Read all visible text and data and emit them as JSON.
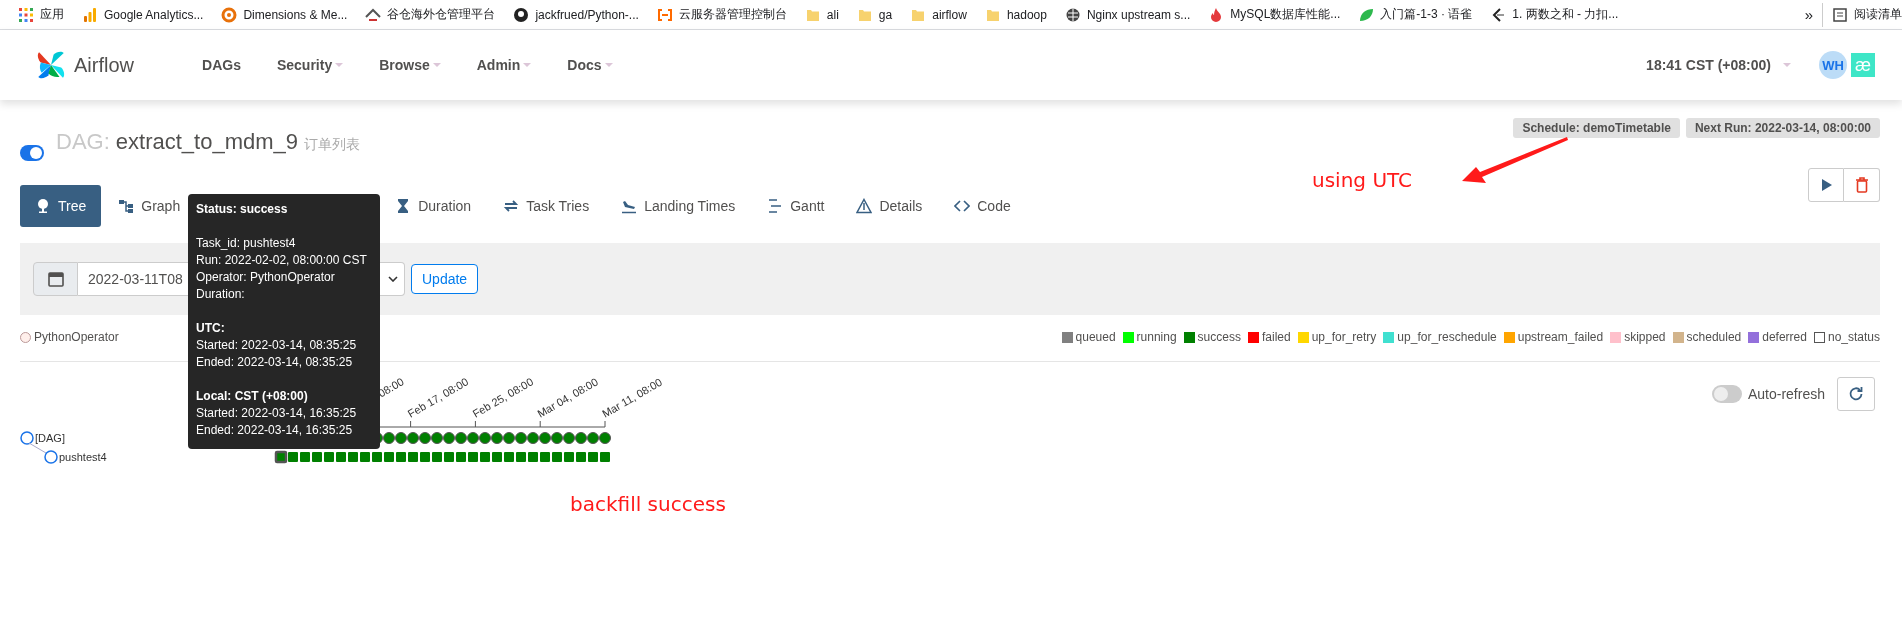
{
  "bookmarks": {
    "items": [
      {
        "kind": "apps",
        "label": "应用"
      },
      {
        "kind": "analytics",
        "label": "Google Analytics..."
      },
      {
        "kind": "dimensions",
        "label": "Dimensions & Me..."
      },
      {
        "kind": "warehouse",
        "label": "谷仓海外仓管理平台"
      },
      {
        "kind": "github",
        "label": "jackfrued/Python-..."
      },
      {
        "kind": "cloud",
        "label": "云服务器管理控制台"
      },
      {
        "kind": "folder",
        "label": "ali"
      },
      {
        "kind": "folder",
        "label": "ga"
      },
      {
        "kind": "folder",
        "label": "airflow"
      },
      {
        "kind": "folder",
        "label": "hadoop"
      },
      {
        "kind": "globe",
        "label": "Nginx upstream s..."
      },
      {
        "kind": "flame",
        "label": "MySQL数据库性能..."
      },
      {
        "kind": "leaf",
        "label": "入门篇-1-3 · 语雀"
      },
      {
        "kind": "leetcode",
        "label": "1. 两数之和 - 力扣..."
      }
    ],
    "more": "»",
    "reading_list": "阅读清单"
  },
  "navbar": {
    "brand": "Airflow",
    "menu": [
      {
        "label": "DAGs",
        "dropdown": false
      },
      {
        "label": "Security",
        "dropdown": true
      },
      {
        "label": "Browse",
        "dropdown": true
      },
      {
        "label": "Admin",
        "dropdown": true
      },
      {
        "label": "Docs",
        "dropdown": true
      }
    ],
    "clock": "18:41 CST (+08:00)",
    "avatar": "WH",
    "extension": "æ"
  },
  "dag": {
    "on": true,
    "prefix": "DAG:",
    "id": "extract_to_mdm_9",
    "description": "订单列表",
    "schedule": "Schedule: demoTimetable",
    "next_run": "Next Run: 2022-03-14, 08:00:00"
  },
  "tabs": [
    {
      "kind": "tree",
      "label": "Tree",
      "selected": true
    },
    {
      "kind": "graph",
      "label": "Graph",
      "selected": false
    },
    {
      "kind": "duration",
      "label": "Duration",
      "selected": false
    },
    {
      "kind": "tries",
      "label": "Task Tries",
      "selected": false
    },
    {
      "kind": "landing",
      "label": "Landing Times",
      "selected": false
    },
    {
      "kind": "gantt",
      "label": "Gantt",
      "selected": false
    },
    {
      "kind": "details",
      "label": "Details",
      "selected": false
    },
    {
      "kind": "code",
      "label": "Code",
      "selected": false
    }
  ],
  "filter": {
    "base_date": "2022-03-11T08",
    "button": "Update"
  },
  "legend": {
    "operators": [
      {
        "label": "PythonOperator",
        "color": "#ffefeb"
      }
    ],
    "states": [
      {
        "label": "queued",
        "color": "#808080"
      },
      {
        "label": "running",
        "color": "#00ff00"
      },
      {
        "label": "success",
        "color": "#008000"
      },
      {
        "label": "failed",
        "color": "#ff0000"
      },
      {
        "label": "up_for_retry",
        "color": "#ffd700"
      },
      {
        "label": "up_for_reschedule",
        "color": "#40e0d0"
      },
      {
        "label": "upstream_failed",
        "color": "#ffa500"
      },
      {
        "label": "skipped",
        "color": "#ffc0cb"
      },
      {
        "label": "scheduled",
        "color": "#d2b48c"
      },
      {
        "label": "deferred",
        "color": "#9370db"
      },
      {
        "label": "no_status",
        "color": "#ffffff"
      }
    ]
  },
  "auto_refresh": {
    "label": "Auto-refresh",
    "on": false
  },
  "tree": {
    "ticks": [
      "08:00",
      "Feb 17, 08:00",
      "Feb 25, 08:00",
      "Mar 04, 08:00",
      "Mar 11, 08:00"
    ],
    "nodes": [
      {
        "label": "[DAG]",
        "runs": [
          {
            "color": "#008000",
            "hovered": false
          },
          {
            "color": "#008000",
            "hovered": false
          },
          {
            "color": "#008000",
            "hovered": false
          },
          {
            "color": "#008000",
            "hovered": false
          },
          {
            "color": "#008000",
            "hovered": false
          },
          {
            "color": "#008000",
            "hovered": false
          },
          {
            "color": "#008000",
            "hovered": false
          },
          {
            "color": "#008000",
            "hovered": false
          },
          {
            "color": "#008000",
            "hovered": false
          },
          {
            "color": "#008000",
            "hovered": false
          },
          {
            "color": "#008000",
            "hovered": false
          },
          {
            "color": "#008000",
            "hovered": false
          },
          {
            "color": "#008000",
            "hovered": false
          },
          {
            "color": "#008000",
            "hovered": false
          },
          {
            "color": "#008000",
            "hovered": false
          },
          {
            "color": "#008000",
            "hovered": false
          },
          {
            "color": "#008000",
            "hovered": false
          },
          {
            "color": "#008000",
            "hovered": false
          },
          {
            "color": "#008000",
            "hovered": false
          },
          {
            "color": "#008000",
            "hovered": false
          }
        ],
        "children": [
          {
            "label": "pushtest4",
            "runs": [
              {
                "color": "#008000",
                "hovered": true
              },
              {
                "color": "#008000",
                "hovered": false
              },
              {
                "color": "#008000",
                "hovered": false
              },
              {
                "color": "#008000",
                "hovered": false
              },
              {
                "color": "#008000",
                "hovered": false
              },
              {
                "color": "#008000",
                "hovered": false
              },
              {
                "color": "#008000",
                "hovered": false
              },
              {
                "color": "#008000",
                "hovered": false
              },
              {
                "color": "#008000",
                "hovered": false
              },
              {
                "color": "#008000",
                "hovered": false
              },
              {
                "color": "#008000",
                "hovered": false
              },
              {
                "color": "#008000",
                "hovered": false
              },
              {
                "color": "#008000",
                "hovered": false
              },
              {
                "color": "#008000",
                "hovered": false
              },
              {
                "color": "#008000",
                "hovered": false
              },
              {
                "color": "#008000",
                "hovered": false
              },
              {
                "color": "#008000",
                "hovered": false
              },
              {
                "color": "#008000",
                "hovered": false
              },
              {
                "color": "#008000",
                "hovered": false
              },
              {
                "color": "#008000",
                "hovered": false
              },
              {
                "color": "#008000",
                "hovered": false
              },
              {
                "color": "#008000",
                "hovered": false
              },
              {
                "color": "#008000",
                "hovered": false
              },
              {
                "color": "#008000",
                "hovered": false
              },
              {
                "color": "#008000",
                "hovered": false
              },
              {
                "color": "#008000",
                "hovered": false
              },
              {
                "color": "#008000",
                "hovered": false
              },
              {
                "color": "#008000",
                "hovered": false
              }
            ]
          }
        ]
      }
    ]
  },
  "tooltip": {
    "sections": [
      [
        {
          "kind": "heading",
          "text": "Status: success"
        }
      ],
      [
        {
          "kind": "line",
          "text": "Task_id: pushtest4"
        },
        {
          "kind": "line",
          "text": "Run: 2022-02-02, 08:00:00 CST"
        },
        {
          "kind": "line",
          "text": "Operator: PythonOperator"
        },
        {
          "kind": "line",
          "text": "Duration:"
        }
      ],
      [
        {
          "kind": "heading",
          "text": "UTC:"
        },
        {
          "kind": "line",
          "text": "Started: 2022-03-14, 08:35:25"
        },
        {
          "kind": "line",
          "text": "Ended: 2022-03-14, 08:35:25"
        }
      ],
      [
        {
          "kind": "heading",
          "text": "Local: CST (+08:00)"
        },
        {
          "kind": "line",
          "text": "Started: 2022-03-14, 16:35:25"
        },
        {
          "kind": "line",
          "text": "Ended: 2022-03-14, 16:35:25"
        }
      ]
    ]
  },
  "annotations": [
    {
      "kind": "arrow-note",
      "text": "using UTC"
    },
    {
      "kind": "note",
      "text": "backfill success"
    }
  ]
}
